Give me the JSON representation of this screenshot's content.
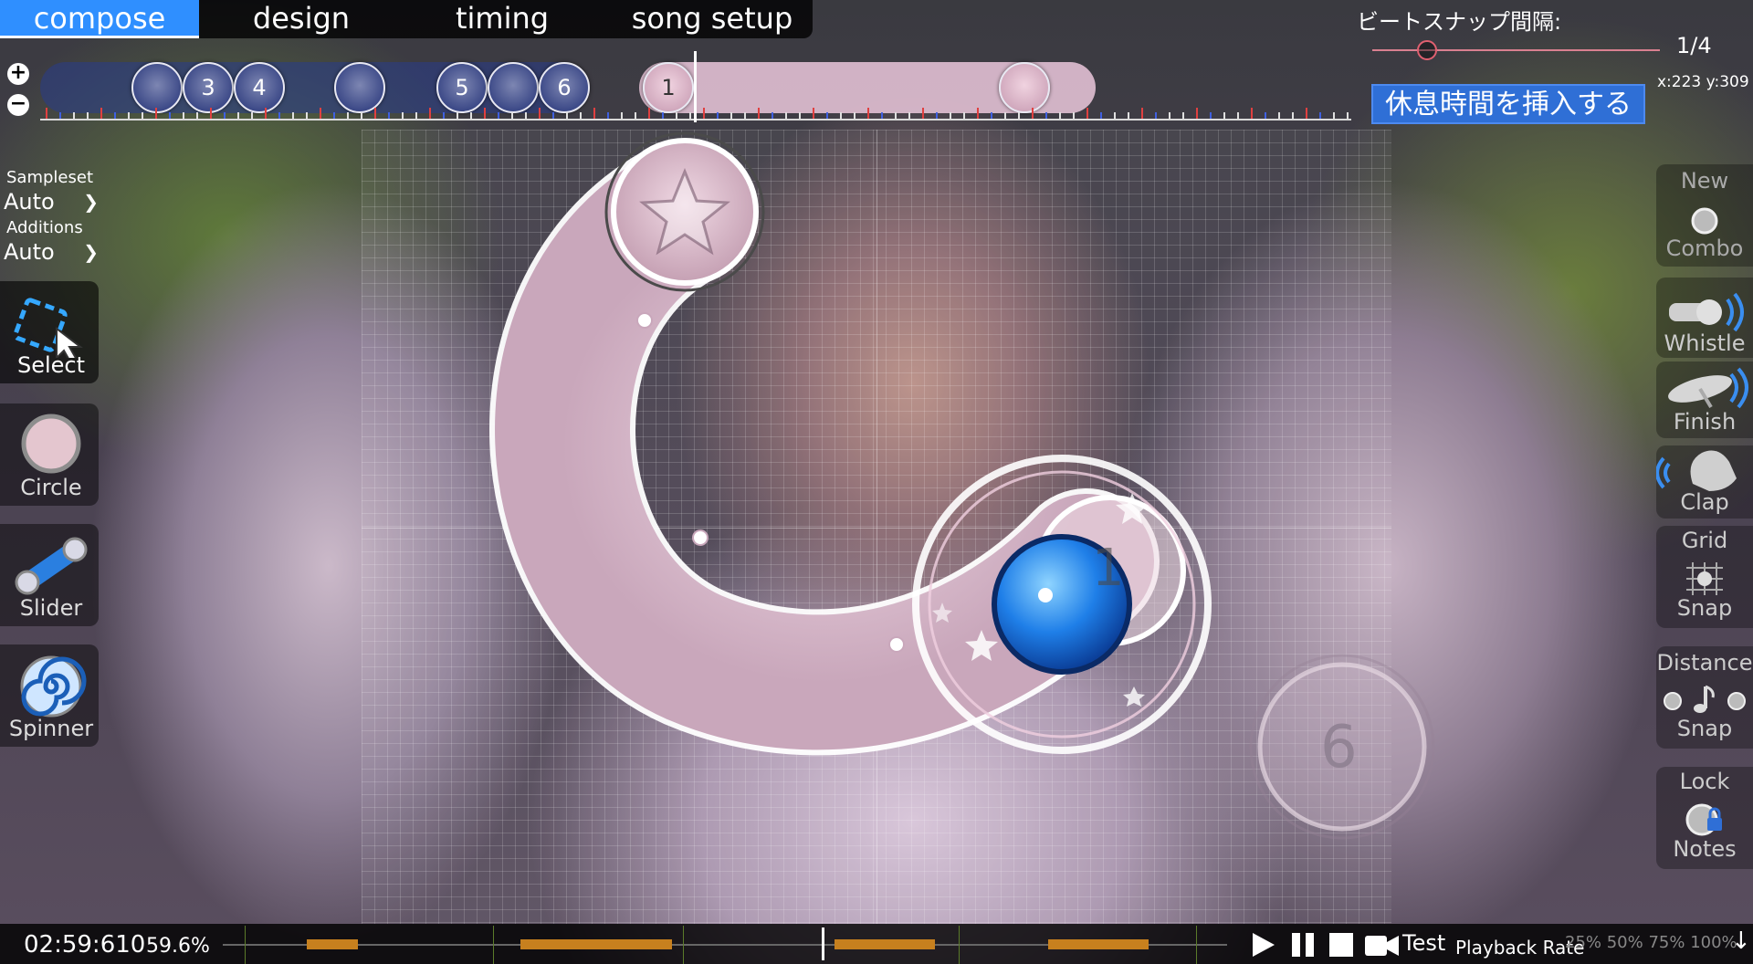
{
  "tabs": [
    {
      "label": "compose",
      "active": true
    },
    {
      "label": "design",
      "active": false
    },
    {
      "label": "timing",
      "active": false
    },
    {
      "label": "song setup",
      "active": false
    }
  ],
  "timeline": {
    "objects": [
      "",
      "3",
      "4",
      "",
      "5",
      "",
      "6",
      "1",
      ""
    ],
    "zoom_in_icon": "plus-circle-icon",
    "zoom_out_icon": "minus-circle-icon"
  },
  "beat_snap": {
    "label": "ビートスナップ間隔:",
    "value": "1/4",
    "level": 0.2
  },
  "cursor": {
    "coords": "x:223 y:309"
  },
  "break_button": "休息時間を挿入する",
  "left_panel": {
    "sampleset_label": "Sampleset",
    "sampleset_value": "Auto",
    "additions_label": "Additions",
    "additions_value": "Auto",
    "tools": [
      {
        "label": "Select",
        "icon": "select-cursor-icon"
      },
      {
        "label": "Circle",
        "icon": "circle-icon"
      },
      {
        "label": "Slider",
        "icon": "slider-icon"
      },
      {
        "label": "Spinner",
        "icon": "spinner-icon"
      }
    ]
  },
  "right_panel": {
    "new_combo": {
      "line1": "New",
      "line2": "Combo"
    },
    "whistle": "Whistle",
    "finish": "Finish",
    "clap": "Clap",
    "grid_snap": {
      "line1": "Grid",
      "line2": "Snap"
    },
    "distance_snap": {
      "line1": "Distance",
      "line2": "Snap"
    },
    "lock_notes": {
      "line1": "Lock",
      "line2": "Notes"
    }
  },
  "playfield": {
    "hit_circle_numbers": [
      "1",
      "6"
    ]
  },
  "bottom": {
    "time": "02:59:610",
    "percent": "59.6%",
    "test_label": "Test",
    "playback_rate_label": "Playback Rate",
    "playback_rate_options": "25% 50% 75% 100%"
  },
  "colors": {
    "accent": "#2f8fff",
    "break_button": "#2f6fd6",
    "timeline_tick_red": "#e04040",
    "timeline_tick_blue": "#4060e0",
    "progress_segment": "#c7801e"
  }
}
